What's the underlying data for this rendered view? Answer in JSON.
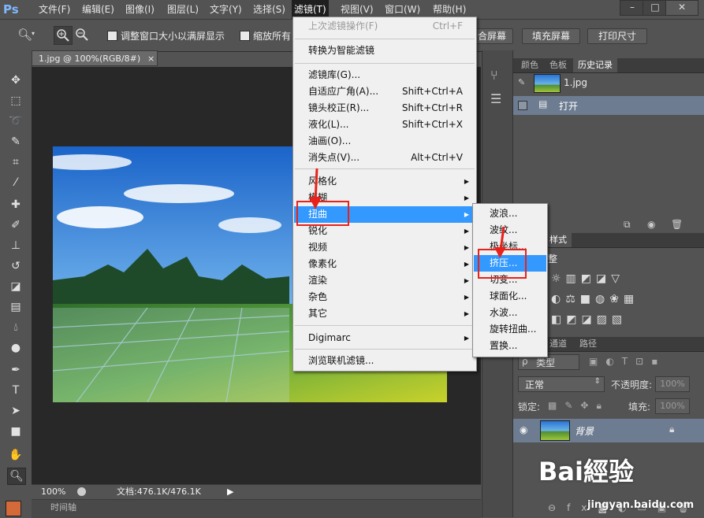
{
  "app": {
    "logo": "Ps"
  },
  "menubar": {
    "items": [
      "文件(F)",
      "编辑(E)",
      "图像(I)",
      "图层(L)",
      "文字(Y)",
      "选择(S)",
      "滤镜(T)",
      "视图(V)",
      "窗口(W)",
      "帮助(H)"
    ],
    "active": "滤镜(T)",
    "window_buttons": [
      "–",
      "□",
      "✕"
    ]
  },
  "options": {
    "check1": "调整窗口大小以满屏显示",
    "check2": "缩放所有",
    "btn_fit": "合屏幕",
    "btn_fill": "填充屏幕",
    "btn_print": "打印尺寸"
  },
  "document": {
    "tab": "1.jpg @ 100%(RGB/8#)",
    "close": "×",
    "zoom": "100%",
    "doc_info": "文档:476.1K/476.1K",
    "timeline": "时间轴"
  },
  "filter_menu": {
    "last": {
      "label": "上次滤镜操作(F)",
      "shortcut": "Ctrl+F"
    },
    "smart": "转换为智能滤镜",
    "group1": [
      {
        "label": "滤镜库(G)...",
        "shortcut": ""
      },
      {
        "label": "自适应广角(A)...",
        "shortcut": "Shift+Ctrl+A"
      },
      {
        "label": "镜头校正(R)...",
        "shortcut": "Shift+Ctrl+R"
      },
      {
        "label": "液化(L)...",
        "shortcut": "Shift+Ctrl+X"
      },
      {
        "label": "油画(O)...",
        "shortcut": ""
      },
      {
        "label": "消失点(V)...",
        "shortcut": "Alt+Ctrl+V"
      }
    ],
    "group2": [
      "风格化",
      "模糊",
      "扭曲",
      "锐化",
      "视频",
      "像素化",
      "渲染",
      "杂色",
      "其它"
    ],
    "highlighted": "扭曲",
    "digimarc": "Digimarc",
    "browse": "浏览联机滤镜..."
  },
  "distort_submenu": {
    "items": [
      "波浪...",
      "波纹...",
      "极坐标...",
      "挤压...",
      "切变...",
      "球面化...",
      "水波...",
      "旋转扭曲...",
      "置换..."
    ],
    "highlighted": "挤压..."
  },
  "panels": {
    "top_tabs": [
      "颜色",
      "色板",
      "历史记录"
    ],
    "active_top": "历史记录",
    "history_file": "1.jpg",
    "history_step": "打开",
    "style_tab": "样式",
    "adjust_label": "整",
    "layer_tabs": [
      "通道",
      "路径"
    ],
    "kind_label": "类型",
    "blend_mode": "正常",
    "opacity_label": "不透明度:",
    "opacity_value": "100%",
    "lock_label": "锁定:",
    "fill_label": "填充:",
    "fill_value": "100%",
    "layer_name": "背景",
    "link_icon": "fx"
  },
  "watermark": {
    "text": "Bai經验",
    "url": "jingyan.baidu.com"
  }
}
